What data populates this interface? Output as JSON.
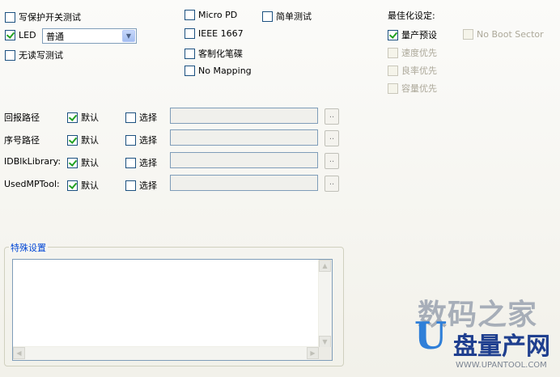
{
  "options": {
    "write_protect_test": "写保护开关测试",
    "led": "LED",
    "led_mode": "普通",
    "no_rw_test": "无读写测试",
    "micro_pd": "Micro PD",
    "ieee_1667": "IEEE 1667",
    "custom_disk": "客制化笔碟",
    "no_mapping": "No Mapping",
    "simple_test": "简单测试"
  },
  "optimize": {
    "title": "最佳化设定:",
    "mass_preset": "量产预设",
    "no_boot_sector": "No Boot Sector",
    "speed_first": "速度优先",
    "yield_first": "良率优先",
    "capacity_first": "容量优先"
  },
  "paths": [
    {
      "label": "回报路径",
      "default": "默认",
      "choose": "选择",
      "browse": ".."
    },
    {
      "label": "序号路径",
      "default": "默认",
      "choose": "选择",
      "browse": ".."
    },
    {
      "label": "IDBlkLibrary:",
      "default": "默认",
      "choose": "选择",
      "browse": ".."
    },
    {
      "label": "UsedMPTool:",
      "default": "默认",
      "choose": "选择",
      "browse": ".."
    }
  ],
  "special": {
    "title": "特殊设置"
  },
  "watermark": {
    "line1": "数码之家",
    "logo_letter": "U",
    "line2": "盘量产网",
    "url": "WWW.UPANTOOL.COM"
  }
}
